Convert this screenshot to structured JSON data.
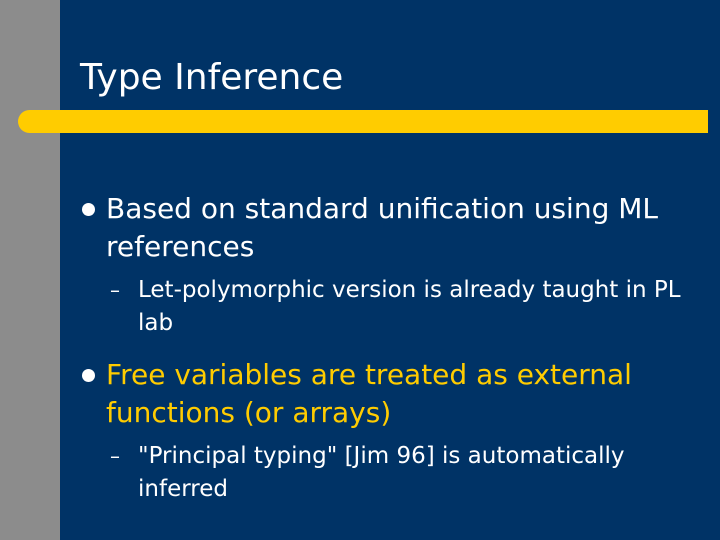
{
  "slide": {
    "title": "Type Inference",
    "bullets": [
      {
        "text": "Based on standard unification using ML references",
        "sub": "Let-polymorphic version is already taught in PL lab"
      },
      {
        "text": "Free variables are treated as external functions (or arrays)",
        "sub": "\"Principal typing\" [Jim 96] is automatically inferred"
      }
    ],
    "sub_marker": "–"
  },
  "colors": {
    "background": "#003366",
    "left_stripe": "#8c8c8c",
    "title_bar": "#ffcc00",
    "title_text": "#ffffff",
    "highlight_text": "#ffcc00"
  }
}
